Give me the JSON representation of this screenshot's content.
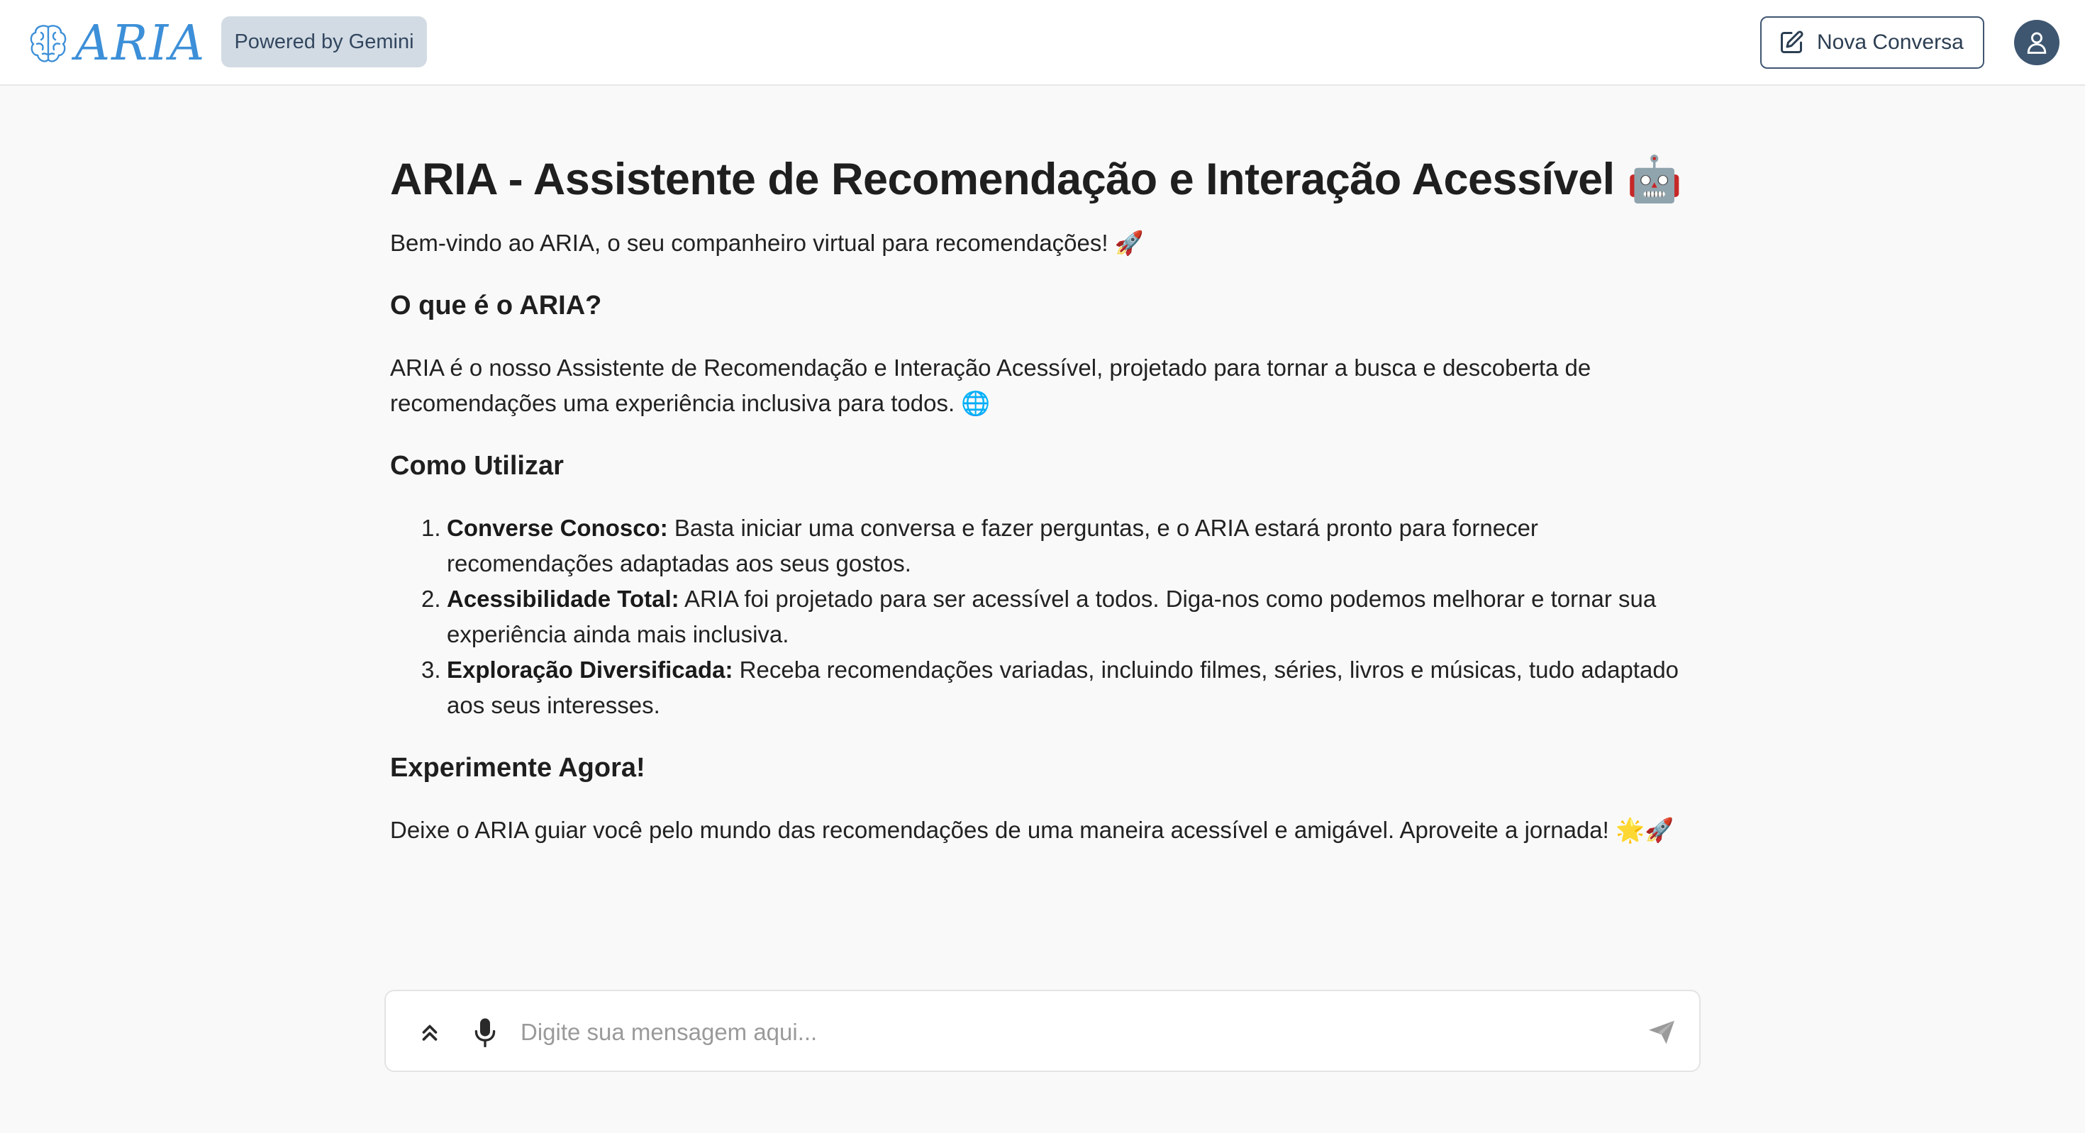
{
  "header": {
    "logo_text": "ARIA",
    "logo_icon": "brain-icon",
    "badge": "Powered by Gemini",
    "new_chat_label": "Nova Conversa",
    "new_chat_icon": "edit-icon",
    "avatar_icon": "user-icon"
  },
  "main": {
    "title": "ARIA - Assistente de Recomendação e Interação Acessível",
    "title_emoji": "🤖",
    "intro": "Bem-vindo ao ARIA, o seu companheiro virtual para recomendações!",
    "intro_emoji": "🚀",
    "sections": {
      "what": {
        "heading": "O que é o ARIA?",
        "text": "ARIA é o nosso Assistente de Recomendação e Interação Acessível, projetado para tornar a busca e descoberta de recomendações uma experiência inclusiva para todos.",
        "emoji": "🌐"
      },
      "how": {
        "heading": "Como Utilizar",
        "items": [
          {
            "num": "1.",
            "bold": "Converse Conosco:",
            "text": " Basta iniciar uma conversa e fazer perguntas, e o ARIA estará pronto para fornecer recomendações adaptadas aos seus gostos."
          },
          {
            "num": "2.",
            "bold": "Acessibilidade Total:",
            "text": " ARIA foi projetado para ser acessível a todos. Diga-nos como podemos melhorar e tornar sua experiência ainda mais inclusiva."
          },
          {
            "num": "3.",
            "bold": "Exploração Diversificada:",
            "text": " Receba recomendações variadas, incluindo filmes, séries, livros e músicas, tudo adaptado aos seus interesses."
          }
        ]
      },
      "try": {
        "heading": "Experimente Agora!",
        "text": "Deixe o ARIA guiar você pelo mundo das recomendações de uma maneira acessível e amigável. Aproveite a jornada!",
        "emoji": "🌟🚀"
      }
    }
  },
  "composer": {
    "placeholder": "Digite sua mensagem aqui...",
    "value": "",
    "expand_icon": "double-chevron-up-icon",
    "mic_icon": "microphone-icon",
    "send_icon": "send-icon"
  },
  "colors": {
    "accent": "#3c8fd8",
    "badge_bg": "#d2dbe4",
    "dark_slate": "#3e5670",
    "background": "#f9f9f9"
  }
}
